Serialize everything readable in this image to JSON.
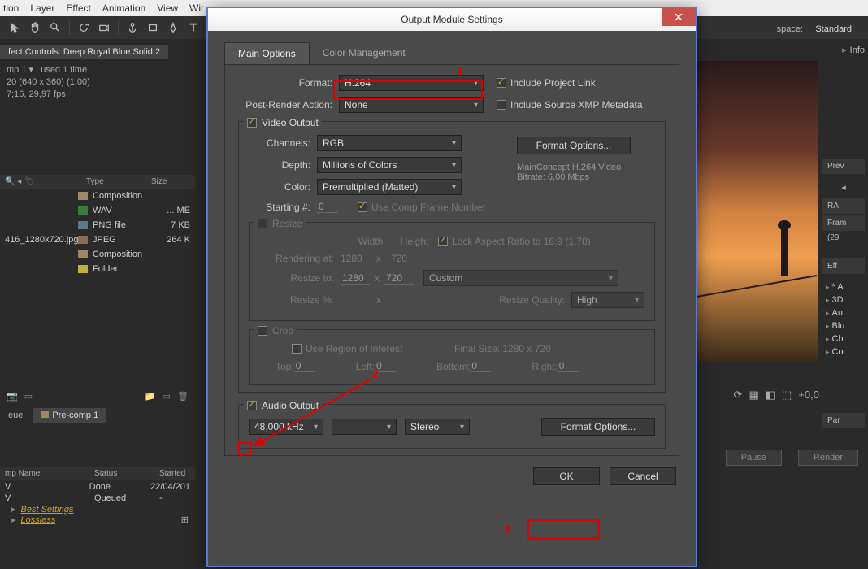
{
  "menubar": {
    "items": [
      "tion",
      "Layer",
      "Effect",
      "Animation",
      "View",
      "Wir"
    ]
  },
  "workspace": {
    "label": "space:",
    "value": "Standard"
  },
  "project": {
    "tab": "fect Controls: Deep Royal Blue Solid 2",
    "line1": "mp 1 ▾ , used 1 time",
    "line2": "20 (640 x 360) (1,00)",
    "line3": "7;16, 29,97 fps",
    "list_headers": {
      "type": "Type",
      "size": "Size"
    },
    "rows": [
      {
        "name": "",
        "type": "Composition",
        "size": ""
      },
      {
        "name": "",
        "type": "WAV",
        "size": "... ME"
      },
      {
        "name": "",
        "type": "PNG file",
        "size": "7 KB"
      },
      {
        "name": "416_1280x720.jpg",
        "type": "JPEG",
        "size": "264 K"
      },
      {
        "name": "",
        "type": "Composition",
        "size": ""
      },
      {
        "name": "",
        "type": "Folder",
        "size": ""
      }
    ]
  },
  "rq": {
    "tabs": [
      "eue",
      "Pre-comp 1"
    ],
    "cols": [
      "mp Name",
      "Status",
      "Started"
    ],
    "rows": [
      {
        "name": "V",
        "status": "Done",
        "started": "22/04/201"
      },
      {
        "name": "V",
        "status": "Queued",
        "started": "-"
      }
    ],
    "best": "Best Settings",
    "lossless": "Lossless"
  },
  "render_buttons": {
    "pause": "Pause",
    "render": "Render"
  },
  "rp": {
    "info": "Info",
    "prev": "Prev",
    "ram": "RA",
    "frame": "Fram",
    "frame_val": "(29",
    "eff": "Eff",
    "items": [
      "* A",
      "3D",
      "Au",
      "Blu",
      "Ch",
      "Co"
    ],
    "par": "Par"
  },
  "dialog": {
    "title": "Output Module Settings",
    "tabs": [
      "Main Options",
      "Color Management"
    ],
    "format_label": "Format:",
    "format_value": "H.264",
    "include_link": "Include Project Link",
    "post_render_label": "Post-Render Action:",
    "post_render_value": "None",
    "include_xmp": "Include Source XMP Metadata",
    "video_output": "Video Output",
    "channels_label": "Channels:",
    "channels_value": "RGB",
    "depth_label": "Depth:",
    "depth_value": "Millions of Colors",
    "color_label": "Color:",
    "color_value": "Premultiplied (Matted)",
    "starting_label": "Starting #:",
    "starting_value": "0",
    "use_comp_frame": "Use Comp Frame Number",
    "format_options": "Format Options...",
    "codec_line1": "MainConcept H.264 Video",
    "codec_line2": "Bitrate: 6,00 Mbps",
    "resize": "Resize",
    "width_label": "Width",
    "height_label": "Height",
    "lock_aspect": "Lock Aspect Ratio to 16:9 (1,78)",
    "rendering_at": "Rendering at:",
    "render_w": "1280",
    "render_h": "720",
    "resize_to": "Resize to:",
    "resize_w": "1280",
    "resize_h": "720",
    "custom": "Custom",
    "resize_pct": "Resize %:",
    "resize_quality_label": "Resize Quality:",
    "resize_quality_value": "High",
    "crop": "Crop",
    "use_roi": "Use Region of Interest",
    "final_size": "Final Size: 1280 x 720",
    "crop_top": "Top:",
    "crop_left": "Left:",
    "crop_bottom": "Bottom:",
    "crop_right": "Right:",
    "crop_val": "0",
    "audio_output": "Audio Output",
    "audio_khz": "48,000 kHz",
    "audio_stereo": "Stereo",
    "ok": "OK",
    "cancel": "Cancel"
  },
  "anno": {
    "n1": "1",
    "n2": "2",
    "n3": "3"
  },
  "timeline_plus": "+0,0"
}
